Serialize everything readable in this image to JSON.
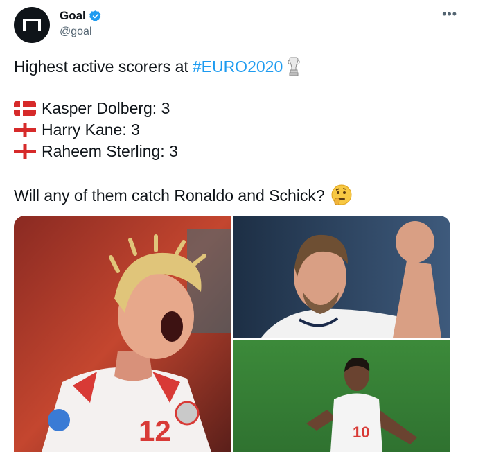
{
  "author": {
    "display_name": "Goal",
    "handle": "@goal",
    "avatar_icon": "goal-logo-icon",
    "verified_icon": "verified-badge-icon"
  },
  "menu": {
    "more_label": "•••"
  },
  "tweet": {
    "headline": "Highest active scorers at",
    "hashtag": "#EURO2020",
    "headline_icon": "trophy-icon",
    "scorers": [
      {
        "flag": "denmark-flag-icon",
        "text": "Kasper Dolberg: 3"
      },
      {
        "flag": "england-flag-icon",
        "text": "Harry Kane: 3"
      },
      {
        "flag": "england-flag-icon",
        "text": "Raheem Sterling: 3"
      }
    ],
    "question": "Will any of them catch Ronaldo and Schick?",
    "question_icon": "thinking-face-icon"
  },
  "media": {
    "photos": [
      {
        "name": "photo-dolberg",
        "shirt_number": "12",
        "colors": {
          "bg": "#b5382c",
          "shirt": "#f4f1f0",
          "hair": "#e0c57a",
          "skin": "#e7a88b"
        }
      },
      {
        "name": "photo-kane",
        "colors": {
          "bg": "#2f4a6b",
          "shirt": "#f2f2f2",
          "skin": "#d99f84"
        }
      },
      {
        "name": "photo-sterling",
        "shirt_number": "10",
        "colors": {
          "bg": "#3d8a3b",
          "shirt": "#f4f4f4",
          "skin": "#6a4330"
        }
      }
    ]
  },
  "colors": {
    "link": "#1d9bf0",
    "secondary_text": "#536471"
  }
}
